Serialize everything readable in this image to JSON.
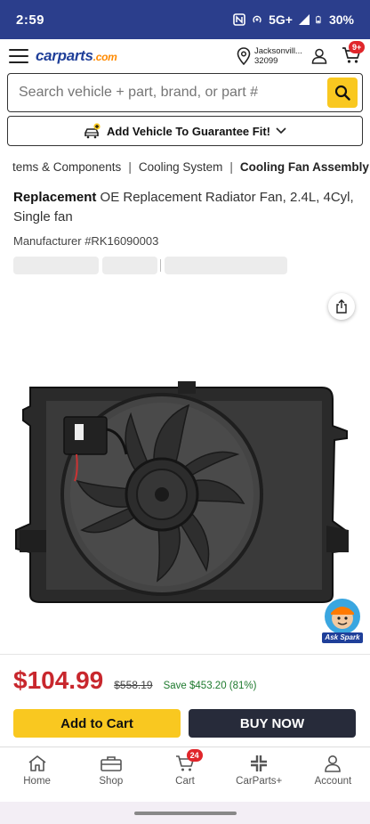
{
  "status_bar": {
    "time": "2:59",
    "network": "5G+",
    "battery": "30%"
  },
  "header": {
    "logo_main": "carparts",
    "logo_suffix": ".com",
    "location_line1": "Jacksonvill...",
    "location_line2": "32099",
    "cart_badge": "9+"
  },
  "search": {
    "placeholder": "Search vehicle + part, brand, or part #"
  },
  "guarantee": {
    "label": "Add Vehicle To Guarantee Fit!"
  },
  "breadcrumb": {
    "items": [
      "tems & Components",
      "Cooling System",
      "Cooling Fan Assembly"
    ],
    "separator": "|"
  },
  "product": {
    "brand": "Replacement",
    "title_rest": " OE Replacement Radiator Fan, 2.4L, 4Cyl, Single fan",
    "manufacturer_label": "Manufacturer #RK16090003"
  },
  "assistant": {
    "label": "Ask Spark"
  },
  "pricing": {
    "price": "$104.99",
    "list_price": "$558.19",
    "savings": "Save $453.20 (81%)"
  },
  "actions": {
    "add_to_cart": "Add to Cart",
    "buy_now": "BUY NOW"
  },
  "bottom_nav": {
    "items": [
      {
        "label": "Home",
        "icon": "home-icon"
      },
      {
        "label": "Shop",
        "icon": "toolbox-icon"
      },
      {
        "label": "Cart",
        "icon": "cart-icon",
        "badge": "24"
      },
      {
        "label": "CarParts+",
        "icon": "carparts-plus-icon"
      },
      {
        "label": "Account",
        "icon": "account-icon"
      }
    ]
  },
  "colors": {
    "status_bar": "#2b3e8c",
    "brand_blue": "#1f3f99",
    "brand_orange": "#ff8a00",
    "accent_yellow": "#f9c820",
    "price_red": "#c8272d",
    "savings_green": "#1e7a2e",
    "buy_now_bg": "#272b3a",
    "badge_red": "#e0262b"
  }
}
